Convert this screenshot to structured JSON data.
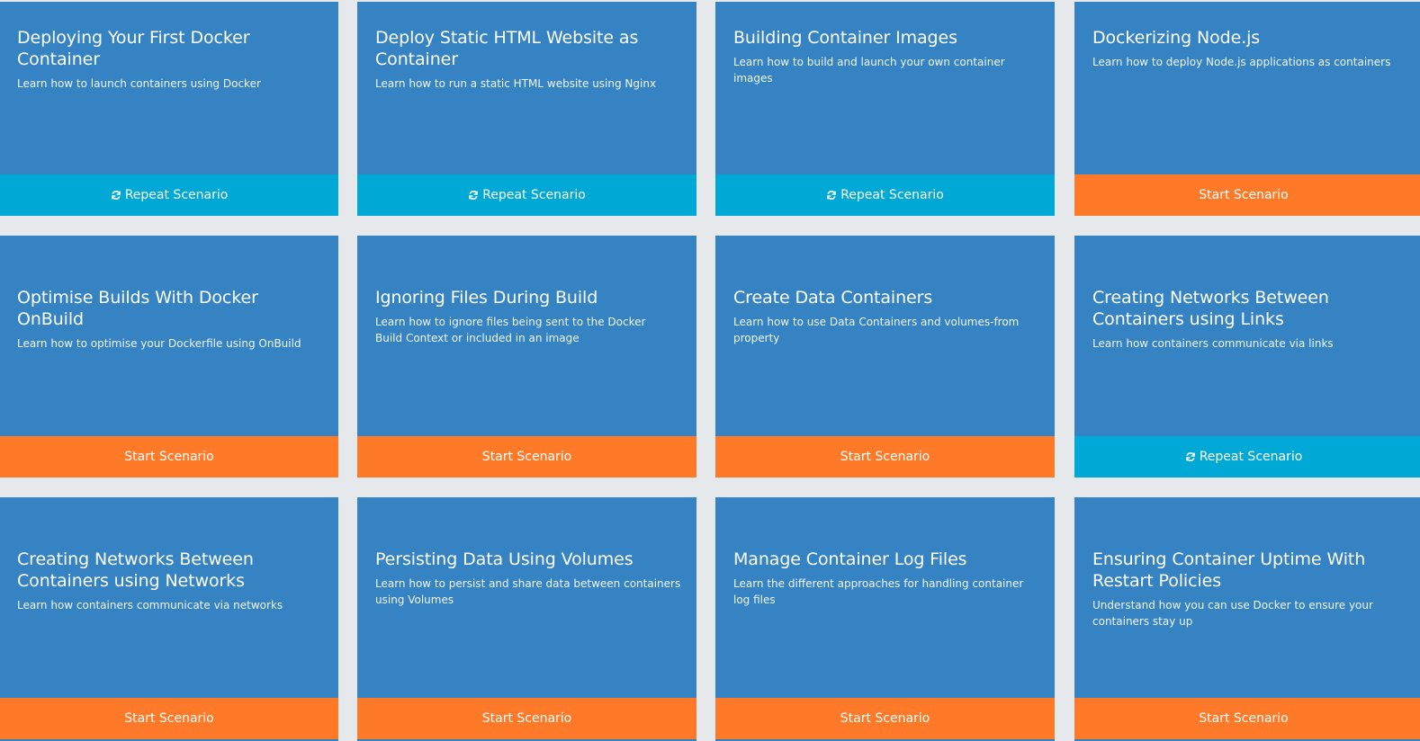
{
  "scenarios": [
    {
      "title": "Deploying Your First Docker Container",
      "description": "Learn how to launch containers using Docker",
      "button": {
        "label": "Repeat Scenario",
        "type": "repeat",
        "icon": "refresh-icon"
      }
    },
    {
      "title": "Deploy Static HTML Website as Container",
      "description": "Learn how to run a static HTML website using Nginx",
      "button": {
        "label": "Repeat Scenario",
        "type": "repeat",
        "icon": "refresh-icon"
      }
    },
    {
      "title": "Building Container Images",
      "description": "Learn how to build and launch your own container images",
      "button": {
        "label": "Repeat Scenario",
        "type": "repeat",
        "icon": "refresh-icon"
      }
    },
    {
      "title": "Dockerizing Node.js",
      "description": "Learn how to deploy Node.js applications as containers",
      "button": {
        "label": "Start Scenario",
        "type": "start"
      }
    },
    {
      "title": "Optimise Builds With Docker OnBuild",
      "description": "Learn how to optimise your Dockerfile using OnBuild",
      "button": {
        "label": "Start Scenario",
        "type": "start"
      }
    },
    {
      "title": "Ignoring Files During Build",
      "description": "Learn how to ignore files being sent to the Docker Build Context or included in an image",
      "button": {
        "label": "Start Scenario",
        "type": "start"
      }
    },
    {
      "title": "Create Data Containers",
      "description": "Learn how to use Data Containers and volumes-from property",
      "button": {
        "label": "Start Scenario",
        "type": "start"
      }
    },
    {
      "title": "Creating Networks Between Containers using Links",
      "description": "Learn how containers communicate via links",
      "button": {
        "label": "Repeat Scenario",
        "type": "repeat",
        "icon": "refresh-icon"
      }
    },
    {
      "title": "Creating Networks Between Containers using Networks",
      "description": "Learn how containers communicate via networks",
      "button": {
        "label": "Start Scenario",
        "type": "start"
      }
    },
    {
      "title": "Persisting Data Using Volumes",
      "description": "Learn how to persist and share data between containers using Volumes",
      "button": {
        "label": "Start Scenario",
        "type": "start"
      }
    },
    {
      "title": "Manage Container Log Files",
      "description": "Learn the different approaches for handling container log files",
      "button": {
        "label": "Start Scenario",
        "type": "start"
      }
    },
    {
      "title": "Ensuring Container Uptime With Restart Policies",
      "description": "Understand how you can use Docker to ensure your containers stay up",
      "button": {
        "label": "Start Scenario",
        "type": "start"
      }
    }
  ],
  "colors": {
    "card": "#3583c3",
    "repeat": "#00a8d6",
    "start": "#ff7a28",
    "background": "#e5e9ec"
  }
}
